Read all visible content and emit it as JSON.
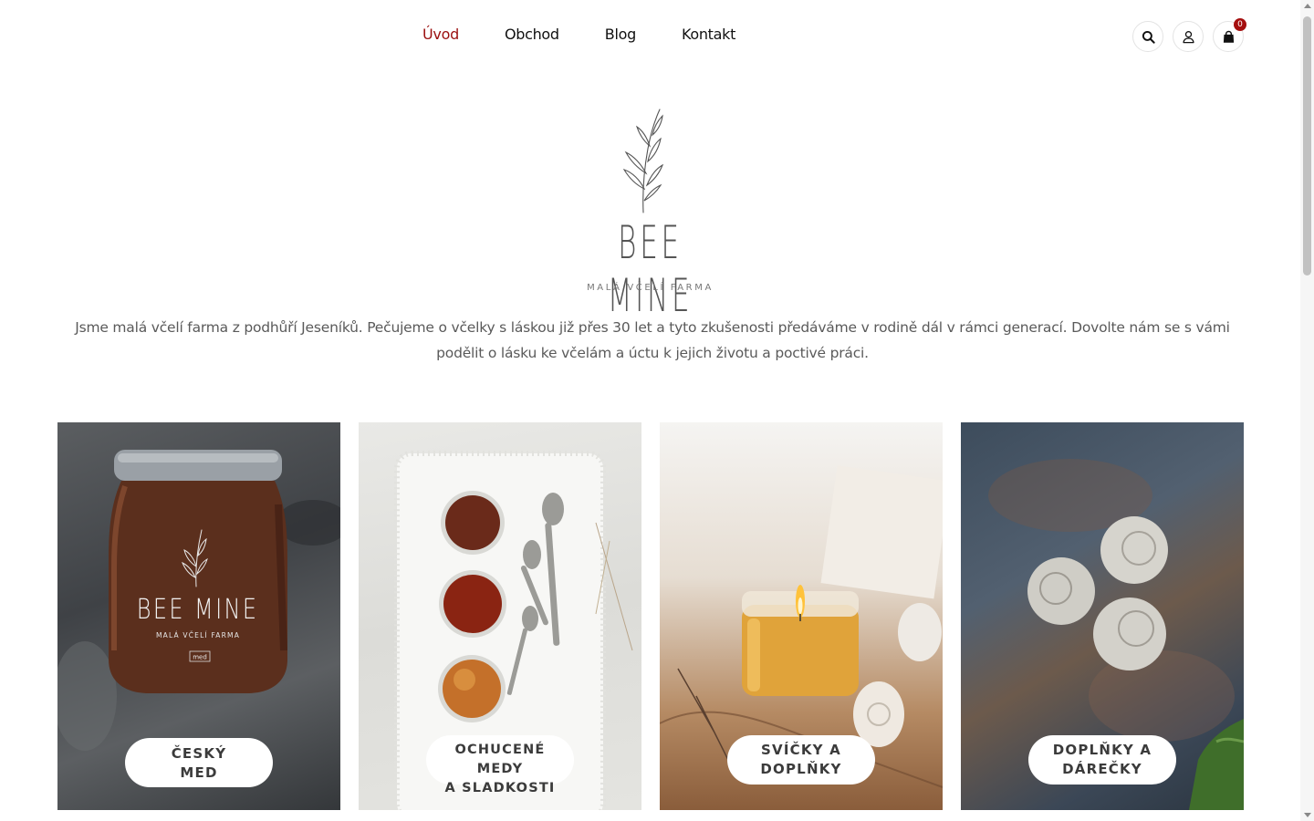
{
  "nav": {
    "items": [
      {
        "label": "Úvod",
        "active": true
      },
      {
        "label": "Obchod",
        "active": false
      },
      {
        "label": "Blog",
        "active": false
      },
      {
        "label": "Kontakt",
        "active": false
      }
    ]
  },
  "header_icons": {
    "search": "search-icon",
    "account": "user-icon",
    "cart": "shopping-bag-icon",
    "cart_count": "0"
  },
  "brand": {
    "name": "BEE MINE",
    "tagline": "MALÁ VČELÍ FARMA"
  },
  "intro": {
    "text": "Jsme malá včelí farma z podhůří Jeseníků. Pečujeme o včelky s láskou již přes 30 let a tyto zkušenosti předáváme v rodině dál v rámci generací. Dovolte nám se s vámi podělit o lásku ke včelám a úctu k jejich životu a poctivé práci."
  },
  "categories": [
    {
      "label": "Český med",
      "line1": "ČESKÝ",
      "line2": "MED",
      "jar_brand": "BEE MINE",
      "jar_tagline": "MALÁ VČELÍ FARMA",
      "jar_tag": "med"
    },
    {
      "label": "Ochucené medy a sladkosti",
      "line1": "OCHUCENÉ MEDY",
      "line2": "A SLADKOSTI"
    },
    {
      "label": "Svíčky a doplňky",
      "line1": "SVÍČKY A",
      "line2": "DOPLŇKY"
    },
    {
      "label": "Doplňky a dárečky",
      "line1": "DOPLŇKY A",
      "line2": "DÁREČKY"
    }
  ],
  "colors": {
    "accent": "#9b1010",
    "badge": "#a50f0f",
    "text": "#5a5a5a"
  }
}
